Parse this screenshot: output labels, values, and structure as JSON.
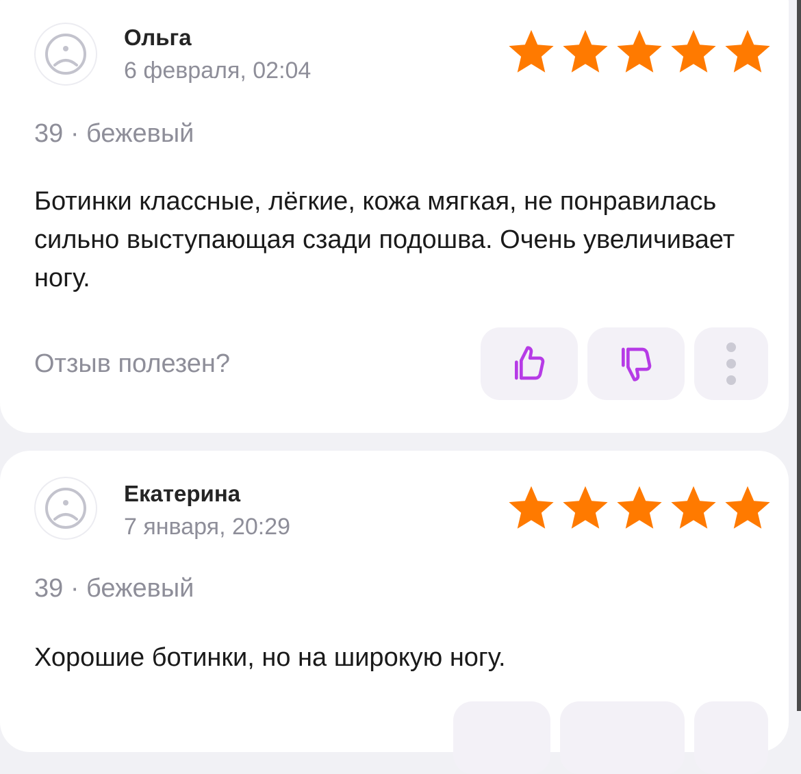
{
  "reviews": [
    {
      "author": "Ольга",
      "date": "6 февраля, 02:04",
      "rating": 5,
      "variant": "39 · бежевый",
      "text": "Ботинки классные, лёгкие, кожа мягкая, не понравилась сильно выступающая сзади подошва. Очень увеличивает ногу.",
      "helpful_prompt": "Отзыв полезен?"
    },
    {
      "author": "Екатерина",
      "date": "7 января, 20:29",
      "rating": 5,
      "variant": "39 · бежевый",
      "text": "Хорошие ботинки, но на широкую ногу."
    }
  ],
  "icons": {
    "avatar": "sad-face-icon",
    "star": "star-icon",
    "like": "thumbs-up-icon",
    "dislike": "thumbs-down-icon",
    "more": "more-vertical-icon"
  },
  "colors": {
    "star": "#ff7a00",
    "vote_icon": "#b63be6",
    "secondary_text": "#8e8e99",
    "button_bg": "#f3f1f7"
  }
}
